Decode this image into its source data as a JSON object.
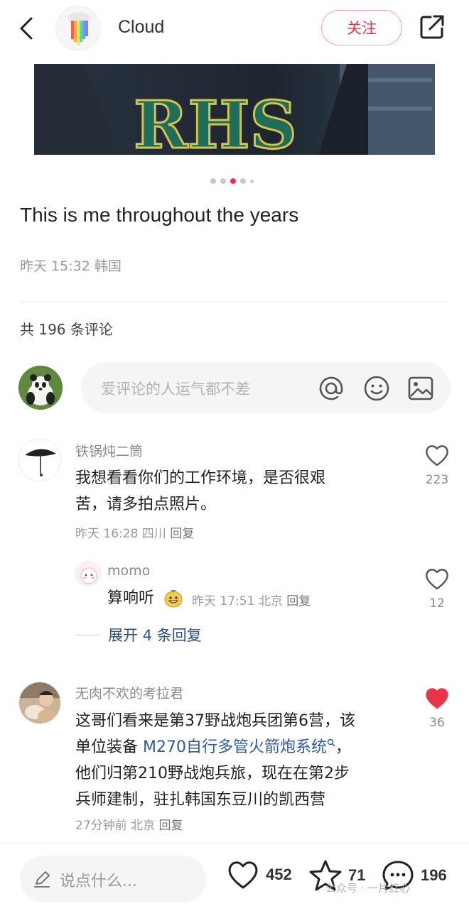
{
  "header": {
    "username": "Cloud",
    "follow_label": "关注"
  },
  "post": {
    "photo_text": "RHS",
    "title": "This is me throughout the years",
    "meta": "昨天 15:32 韩国",
    "carousel": {
      "count": 5,
      "active_index": 2
    }
  },
  "comments_section": {
    "count_label": "共 196 条评论",
    "input_placeholder": "爱评论的人运气都不差"
  },
  "comments": [
    {
      "name": "铁锅炖二筒",
      "text_line1": "我想看看你们的工作环境，是否很艰",
      "text_line2": "苦，请多拍点照片。",
      "meta": "昨天 16:28 四川",
      "reply_label": "回复",
      "likes": "223"
    },
    {
      "name": "momo",
      "text": "算响听",
      "meta": "昨天 17:51 北京",
      "reply_label": "回复",
      "likes": "12"
    },
    {
      "name": "无肉不欢的考拉君",
      "text_line1": "这哥们看来是第37野战炮兵团第6营，该",
      "text_line2_prefix": "单位装备 ",
      "text_line2_link": "M270自行多管火箭炮系统",
      "text_line2_suffix": "，",
      "text_line3": "他们归第210野战炮兵旅，现在在第2步",
      "text_line4": "兵师建制，驻扎韩国东豆川的凯西营",
      "meta": "27分钟前 北京",
      "reply_label": "回复",
      "likes": "36",
      "liked": true
    }
  ],
  "expand_replies": "展开 4 条回复",
  "bottom_bar": {
    "say_placeholder": "说点什么...",
    "likes": "452",
    "stars": "71",
    "comments": "196"
  },
  "watermark": "公众号 · 一片红心",
  "colors": {
    "accent": "#e8344a",
    "link": "#2f5c98",
    "muted": "#999999"
  }
}
